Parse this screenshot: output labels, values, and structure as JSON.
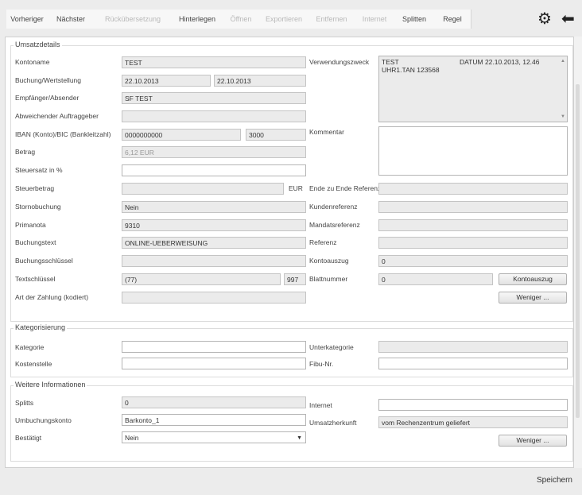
{
  "toolbar": {
    "buttons": [
      "Vorheriger",
      "Nächster",
      "Rückübersetzung",
      "Hinterlegen",
      "Öffnen",
      "Exportieren",
      "Entfernen",
      "Internet",
      "Splitten",
      "Regel"
    ]
  },
  "details": {
    "title": "Umsatzdetails",
    "kontoname_label": "Kontoname",
    "kontoname": "TEST",
    "buchung_label": "Buchung/Wertstellung",
    "buchung": "22.10.2013",
    "wertstellung": "22.10.2013",
    "empfaenger_label": "Empfänger/Absender",
    "empfaenger": "SF TEST",
    "auftraggeber_label": "Abweichender Auftraggeber",
    "auftraggeber": "",
    "iban_label": "IBAN (Konto)/BIC (Bankleitzahl)",
    "iban": "0000000000",
    "bic": "3000",
    "betrag_label": "Betrag",
    "betrag": "6,12 EUR",
    "steuersatz_label": "Steuersatz in %",
    "steuersatz": "",
    "steuerbetrag_label": "Steuerbetrag",
    "steuerbetrag": "",
    "steuer_waehrung": "EUR",
    "storno_label": "Stornobuchung",
    "storno": "Nein",
    "primanota_label": "Primanota",
    "primanota": "9310",
    "buchungstext_label": "Buchungstext",
    "buchungstext": "ONLINE-UEBERWEISUNG",
    "buchungsschluessel_label": "Buchungsschlüssel",
    "buchungsschluessel": "",
    "textschluessel_label": "Textschlüssel",
    "textschluessel": "(77)",
    "textschluessel_ext": "997",
    "zahlungsart_label": "Art der Zahlung (kodiert)",
    "zahlungsart": "",
    "verwendungszweck_label": "Verwendungszweck",
    "verwendungszweck_line1": "TEST",
    "verwendungszweck_date": "DATUM 22.10.2013, 12.46",
    "verwendungszweck_line2": "UHR1.TAN 123568",
    "kommentar_label": "Kommentar",
    "kommentar": "",
    "e2e_label": "Ende zu Ende Referenz",
    "e2e": "",
    "kundenreferenz_label": "Kundenreferenz",
    "kundenreferenz": "",
    "mandatsreferenz_label": "Mandatsreferenz",
    "mandatsreferenz": "",
    "referenz_label": "Referenz",
    "referenz": "",
    "kontoauszug_label": "Kontoauszug",
    "kontoauszug": "0",
    "blattnummer_label": "Blattnummer",
    "blattnummer": "0",
    "kontoauszug_button": "Kontoauszug",
    "weniger_button": "Weniger ..."
  },
  "kategorie": {
    "title": "Kategorisierung",
    "kategorie_label": "Kategorie",
    "kategorie": "",
    "kostenstelle_label": "Kostenstelle",
    "kostenstelle": "",
    "unterkategorie_label": "Unterkategorie",
    "unterkategorie": "",
    "fibu_label": "Fibu-Nr.",
    "fibu": ""
  },
  "weitere": {
    "title": "Weitere Informationen",
    "splitts_label": "Splitts",
    "splitts": "0",
    "umbuchung_label": "Umbuchungskonto",
    "umbuchung": "Barkonto_1",
    "bestaetigt_label": "Bestätigt",
    "bestaetigt": "Nein",
    "internet_label": "Internet",
    "internet": "",
    "herkunft_label": "Umsatzherkunft",
    "herkunft": "vom Rechenzentrum geliefert",
    "weniger_button": "Weniger ..."
  },
  "footer": {
    "save": "Speichern"
  },
  "icons": [
    "gear-icon",
    "back-arrow-icon",
    "dropdown-arrow-icon"
  ]
}
